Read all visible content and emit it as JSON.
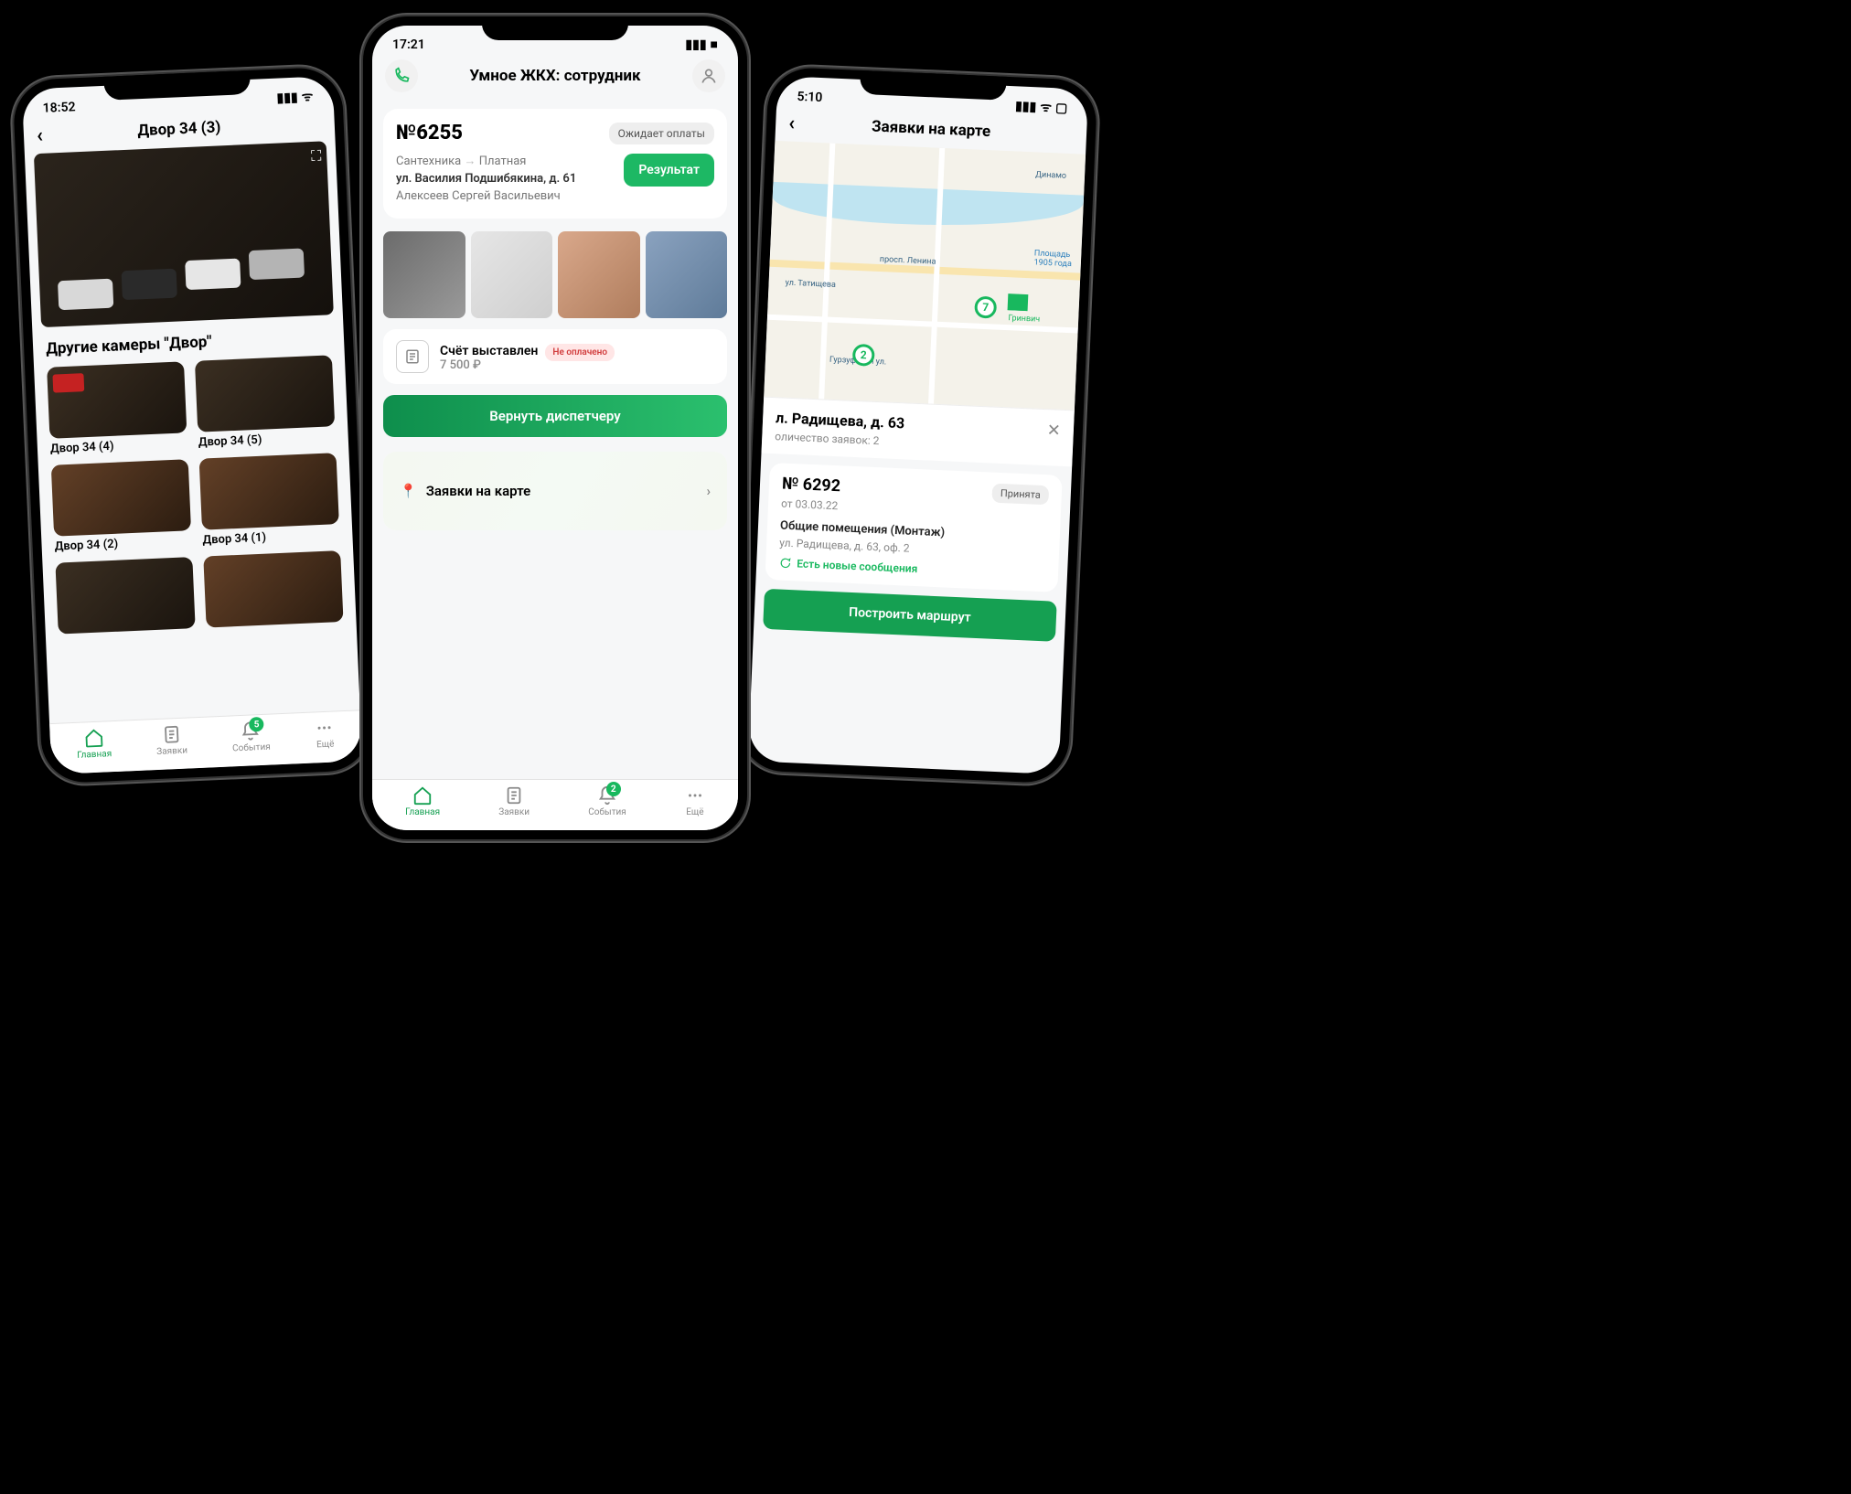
{
  "left": {
    "time": "18:52",
    "header": "Двор 34 (3)",
    "section": "Другие камеры \"Двор\"",
    "cams": [
      {
        "label": "Двор 34 (4)"
      },
      {
        "label": "Двор 34 (5)"
      },
      {
        "label": "Двор 34 (2)"
      },
      {
        "label": "Двор 34 (1)"
      }
    ],
    "tabs": {
      "home": "Главная",
      "req": "Заявки",
      "ev": "События",
      "more": "Ещё",
      "badge": "5"
    }
  },
  "center": {
    "time": "17:21",
    "app_title": "Умное ЖКХ: сотрудник",
    "req_number": "№6255",
    "status_chip": "Ожидает оплаты",
    "cat1": "Сантехника",
    "cat2": "Платная",
    "address": "ул. Василия Подшибякина, д. 61",
    "person": "Алексеев Сергей Васильевич",
    "result_btn": "Результат",
    "bill_title": "Счёт выставлен",
    "bill_amount": "7 500 ₽",
    "bill_badge": "Не оплачено",
    "return_btn": "Вернуть диспетчеру",
    "map_link": "Заявки на карте",
    "tabs": {
      "home": "Главная",
      "req": "Заявки",
      "ev": "События",
      "more": "Ещё",
      "badge": "2"
    }
  },
  "right": {
    "time": "5:10",
    "header": "Заявки на карте",
    "marker_a": "7",
    "marker_b": "2",
    "m_labels": {
      "dinamo": "Динамо",
      "plosh1": "Площадь",
      "plosh2": "1905 года",
      "grin": "Гринвич",
      "lenin": "просп. Ленина",
      "tat": "ул. Татищева",
      "gurz": "Гурзуфская ул."
    },
    "addr_title": "л. Радищева, д. 63",
    "addr_sub": "оличество заявок: 2",
    "card_num": "№ 6292",
    "card_chip": "Принята",
    "card_date": "от 03.03.22",
    "card_cat": "Общие помещения (Монтаж)",
    "card_addr": "ул. Радищева, д. 63, оф. 2",
    "card_msg": "Есть новые сообщения",
    "route_btn": "Построить маршрут"
  }
}
